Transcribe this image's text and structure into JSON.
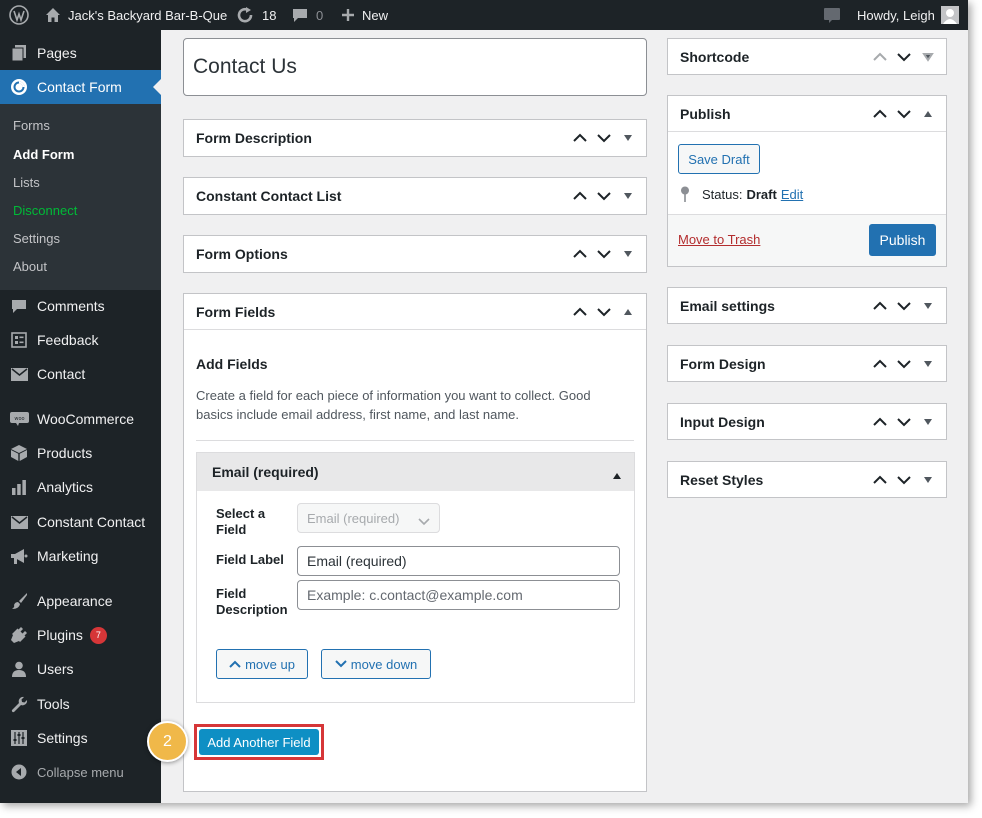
{
  "admin_bar": {
    "site_name": "Jack's Backyard Bar-B-Que",
    "updates_count": "18",
    "comments_count": "0",
    "new_label": "New",
    "howdy": "Howdy, Leigh"
  },
  "sidebar": {
    "pages": "Pages",
    "contact_form": "Contact Form",
    "submenu": {
      "forms": "Forms",
      "add_form": "Add Form",
      "lists": "Lists",
      "disconnect": "Disconnect",
      "settings": "Settings",
      "about": "About"
    },
    "comments": "Comments",
    "feedback": "Feedback",
    "contact": "Contact",
    "woocommerce": "WooCommerce",
    "products": "Products",
    "analytics": "Analytics",
    "constant_contact": "Constant Contact",
    "marketing": "Marketing",
    "appearance": "Appearance",
    "plugins": "Plugins",
    "plugins_badge": "7",
    "users": "Users",
    "tools": "Tools",
    "settings": "Settings",
    "collapse": "Collapse menu"
  },
  "editor": {
    "title": "Contact Us",
    "boxes": {
      "form_description": "Form Description",
      "constant_contact_list": "Constant Contact List",
      "form_options": "Form Options",
      "form_fields": "Form Fields"
    },
    "add_fields_heading": "Add Fields",
    "add_fields_desc": "Create a field for each piece of information you want to collect. Good basics include email address, first name, and last name.",
    "field": {
      "header": "Email (required)",
      "select_label": "Select a Field",
      "select_value": "Email (required)",
      "label_label": "Field Label",
      "label_value": "Email (required)",
      "desc_label": "Field Description",
      "desc_placeholder": "Example: c.contact@example.com",
      "move_up": "move up",
      "move_down": "move down"
    },
    "add_another": "Add Another Field",
    "step_number": "2",
    "highlight_color": "#d63638",
    "step_color": "#f0b849"
  },
  "side": {
    "shortcode": "Shortcode",
    "publish": "Publish",
    "save_draft": "Save Draft",
    "status_label": "Status:",
    "status_value": "Draft",
    "edit": "Edit",
    "move_to_trash": "Move to Trash",
    "publish_button": "Publish",
    "email_settings": "Email settings",
    "form_design": "Form Design",
    "input_design": "Input Design",
    "reset_styles": "Reset Styles"
  }
}
